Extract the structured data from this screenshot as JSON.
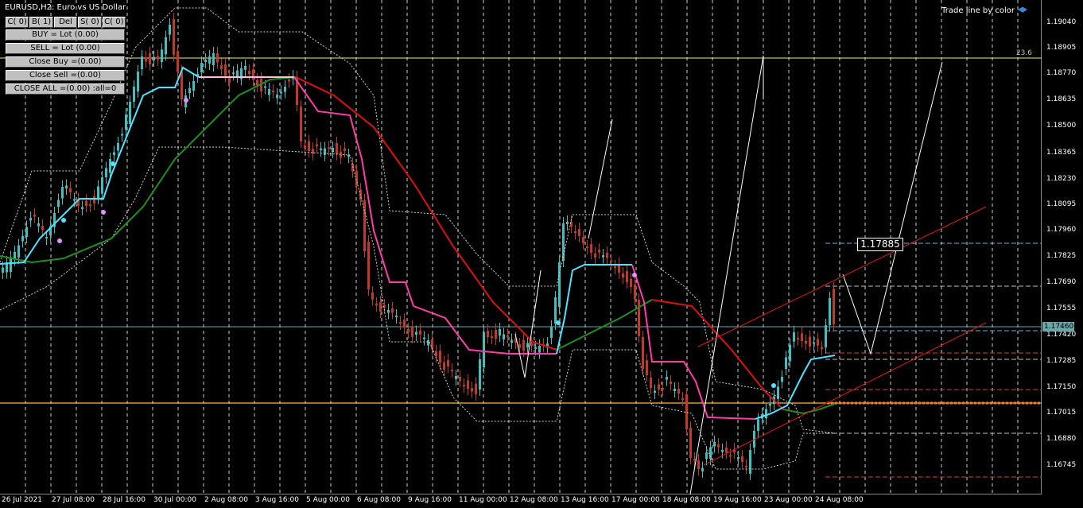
{
  "chart": {
    "title": "EURUSD,H2:  Euro vs US Dollar",
    "trade_line_label": "Trade line by color",
    "trade_line_icon": "graduation-cap-icon",
    "fib_level_label": "23.6",
    "current_price_tag": "1.17460",
    "price_box_label": "1.17885"
  },
  "buttons": {
    "top_row": [
      "C( 0)",
      "B( 1)",
      "Del",
      "S( 0)",
      "C( 0)"
    ],
    "buy": "BUY = Lot (0.00)",
    "sell": "SELL = Lot (0.00)",
    "close_buy": "Close  Buy =(0.00)",
    "close_sell": "Close  Sell =(0.00)",
    "close_all": "CLOSE  ALL =(0.00) :all=0"
  },
  "price_axis": [
    "1.19040",
    "1.18905",
    "1.18770",
    "1.18635",
    "1.18500",
    "1.18365",
    "1.18230",
    "1.18095",
    "1.17960",
    "1.17825",
    "1.17690",
    "1.17555",
    "1.17420",
    "1.17285",
    "1.17150",
    "1.17015",
    "1.16880",
    "1.16745"
  ],
  "time_axis": [
    "26 Jul 2021",
    "27 Jul 08:00",
    "28 Jul 16:00",
    "30 Jul 00:00",
    "2 Aug 08:00",
    "3 Aug 16:00",
    "5 Aug 00:00",
    "6 Aug 08:00",
    "9 Aug 16:00",
    "11 Aug 00:00",
    "12 Aug 08:00",
    "13 Aug 16:00",
    "17 Aug 00:00",
    "18 Aug 08:00",
    "19 Aug 16:00",
    "23 Aug 00:00",
    "24 Aug 08:00"
  ],
  "colors": {
    "background": "#000000",
    "grid": "#ffffff",
    "bull_candle": "#3fbfbf",
    "bear_candle": "#c0392b",
    "fast_ma_up": "#4fe3ff",
    "fast_ma_down": "#ff3ca8",
    "slow_ma_up": "#1f8f1f",
    "slow_ma_down": "#e01010",
    "envelope": "#d0d0d0",
    "fib_line": "#e8e8a0",
    "bid_line": "#6aa6aa",
    "orange_line": "#ffb050"
  }
}
